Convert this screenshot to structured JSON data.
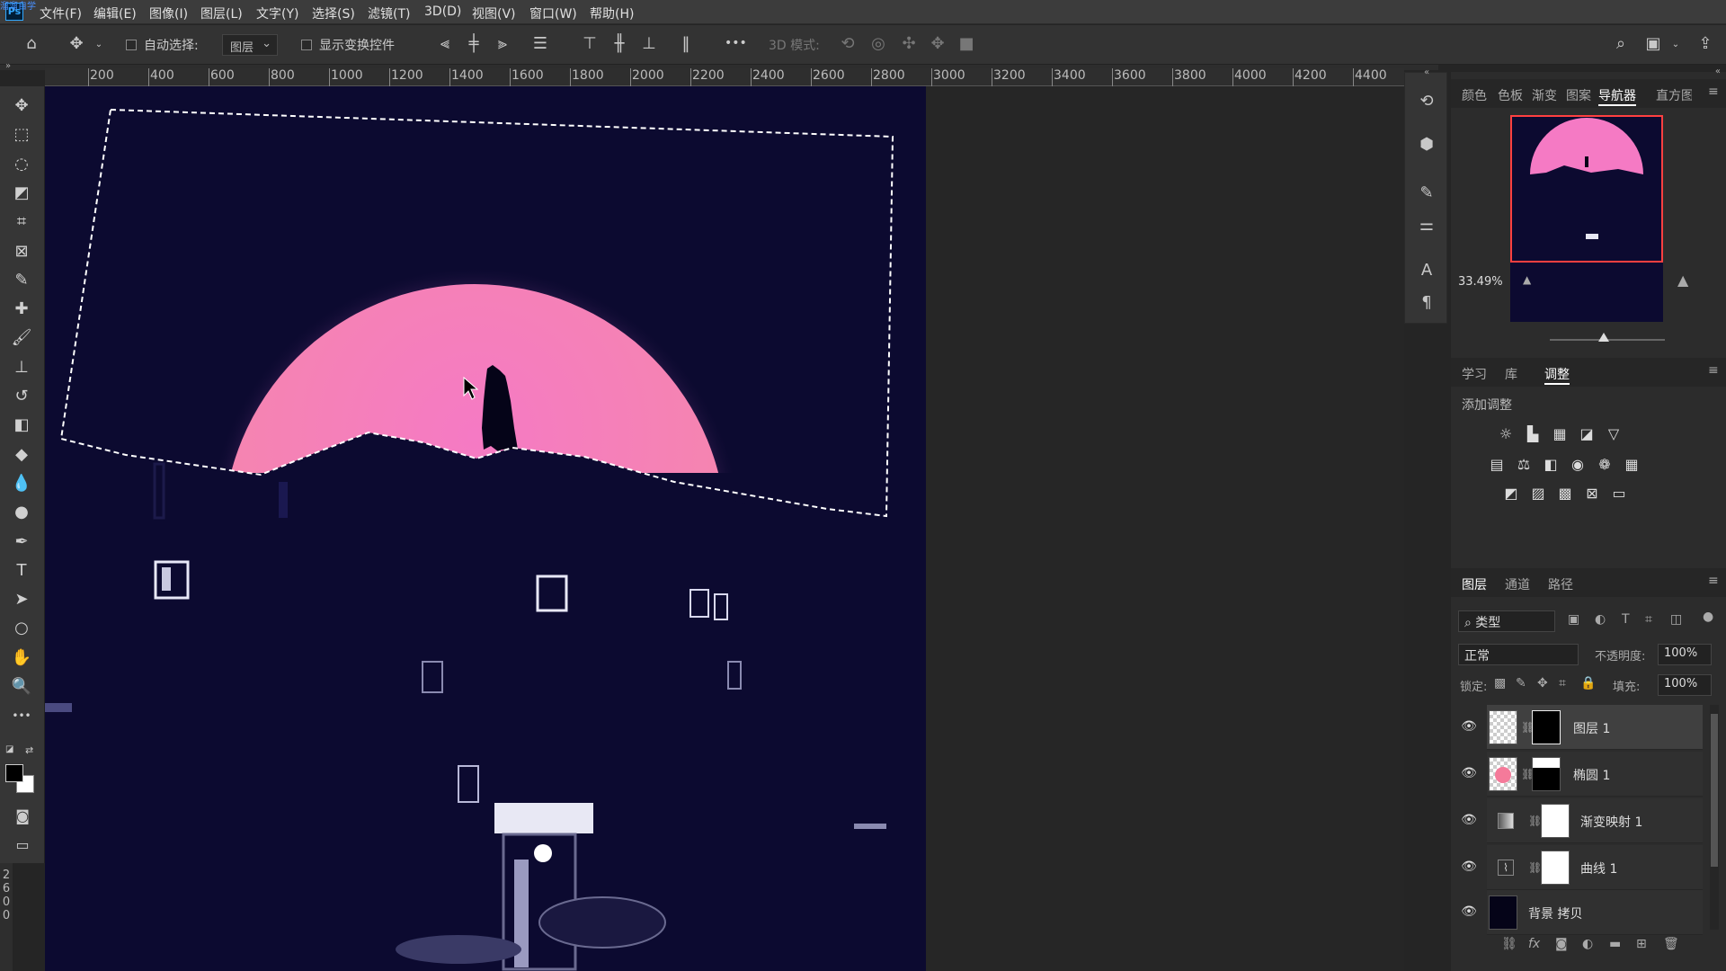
{
  "app": {
    "logo": "Ps",
    "watermark": "溜溜自学"
  },
  "menu": [
    "文件(F)",
    "编辑(E)",
    "图像(I)",
    "图层(L)",
    "文字(Y)",
    "选择(S)",
    "滤镜(T)",
    "3D(D)",
    "视图(V)",
    "窗口(W)",
    "帮助(H)"
  ],
  "options": {
    "auto_select_label": "自动选择:",
    "auto_select_target": "图层",
    "show_transform_label": "显示变换控件",
    "more": "•••",
    "mode_3d_label": "3D 模式:"
  },
  "ruler": {
    "h_ticks": [
      "200",
      "400",
      "600",
      "800",
      "1000",
      "1200",
      "1400",
      "1600",
      "1800",
      "2000",
      "2200",
      "2400",
      "2600",
      "2800",
      "3000",
      "3200",
      "3400",
      "3600",
      "3800",
      "4000",
      "4200",
      "4400"
    ],
    "v_ticks": [
      "2",
      "6",
      "0",
      "0"
    ]
  },
  "tools": [
    {
      "name": "move-tool",
      "glyph": "✥"
    },
    {
      "name": "marquee-tool",
      "glyph": "⬚"
    },
    {
      "name": "lasso-tool",
      "glyph": "◌"
    },
    {
      "name": "object-select-tool",
      "glyph": "◩"
    },
    {
      "name": "crop-tool",
      "glyph": "⌗"
    },
    {
      "name": "frame-tool",
      "glyph": "⊠"
    },
    {
      "name": "eyedropper-tool",
      "glyph": "✎"
    },
    {
      "name": "healing-tool",
      "glyph": "✚"
    },
    {
      "name": "brush-tool",
      "glyph": "🖌"
    },
    {
      "name": "stamp-tool",
      "glyph": "⊥"
    },
    {
      "name": "history-brush-tool",
      "glyph": "↺"
    },
    {
      "name": "eraser-tool",
      "glyph": "◧"
    },
    {
      "name": "paint-bucket-tool",
      "glyph": "◆"
    },
    {
      "name": "blur-tool",
      "glyph": "💧"
    },
    {
      "name": "dodge-tool",
      "glyph": "●"
    },
    {
      "name": "pen-tool",
      "glyph": "✒"
    },
    {
      "name": "type-tool",
      "glyph": "T"
    },
    {
      "name": "path-select-tool",
      "glyph": "➤"
    },
    {
      "name": "ellipse-tool",
      "glyph": "○"
    },
    {
      "name": "hand-tool",
      "glyph": "✋"
    },
    {
      "name": "zoom-tool",
      "glyph": "🔍"
    },
    {
      "name": "more-tools",
      "glyph": "•••"
    }
  ],
  "panels": {
    "top_tabs": [
      "颜色",
      "色板",
      "渐变",
      "图案",
      "导航器",
      "直方图"
    ],
    "zoom": "33.49%",
    "mid_tabs": [
      "学习",
      "库",
      "调整"
    ],
    "add_adjustment": "添加调整",
    "layers_tabs": [
      "图层",
      "通道",
      "路径"
    ],
    "filter_kind": "类型",
    "blend_mode": "正常",
    "opacity_label": "不透明度:",
    "opacity_value": "100%",
    "lock_label": "锁定:",
    "fill_label": "填充:",
    "fill_value": "100%",
    "layers": [
      {
        "name": "图层 1",
        "selected": true
      },
      {
        "name": "椭圆 1",
        "selected": false
      },
      {
        "name": "渐变映射 1",
        "selected": false
      },
      {
        "name": "曲线 1",
        "selected": false
      },
      {
        "name": "背景 拷贝",
        "selected": false
      }
    ]
  },
  "colors": {
    "moon": "#f57ac4",
    "night": "#0c0a30",
    "accent": "#ff4040"
  }
}
